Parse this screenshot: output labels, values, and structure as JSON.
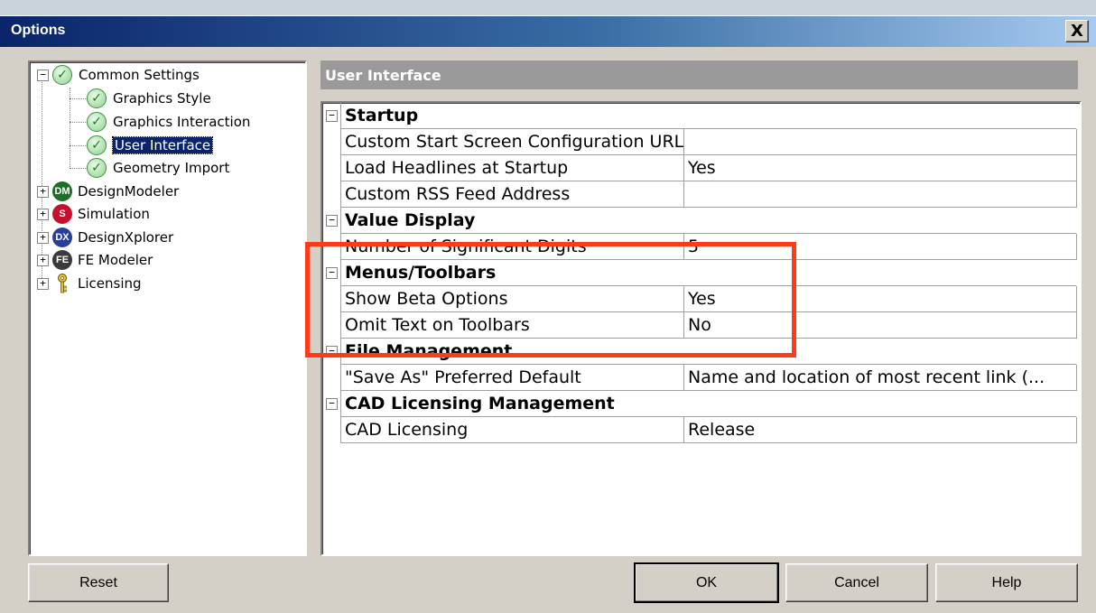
{
  "window": {
    "title": "Options",
    "close_glyph": "X"
  },
  "tree": {
    "items": [
      {
        "label": "Common Settings",
        "icon": "check-icon",
        "expander": "−"
      },
      {
        "label": "Graphics Style",
        "icon": "check-icon"
      },
      {
        "label": "Graphics Interaction",
        "icon": "check-icon"
      },
      {
        "label": "User Interface",
        "icon": "check-icon",
        "selected": true
      },
      {
        "label": "Geometry Import",
        "icon": "check-icon"
      },
      {
        "label": "DesignModeler",
        "icon": "designmodeler-icon",
        "badge": "DM",
        "color": "#1e6e2a",
        "expander": "+"
      },
      {
        "label": "Simulation",
        "icon": "simulation-icon",
        "badge": "S",
        "color": "#c8102e",
        "expander": "+"
      },
      {
        "label": "DesignXplorer",
        "icon": "designxplorer-icon",
        "badge": "DX",
        "color": "#2a3f9a",
        "expander": "+"
      },
      {
        "label": "FE Modeler",
        "icon": "fe-modeler-icon",
        "badge": "FE",
        "color": "#3a3a3a",
        "expander": "+"
      },
      {
        "label": "Licensing",
        "icon": "key-icon",
        "expander": "+"
      }
    ]
  },
  "panel": {
    "title": "User Interface"
  },
  "grid": {
    "collapse_glyph": "−",
    "rows": [
      {
        "type": "category",
        "label": "Startup"
      },
      {
        "type": "prop",
        "name": "Custom Start Screen Configuration URL",
        "value": ""
      },
      {
        "type": "prop",
        "name": "Load Headlines at Startup",
        "value": "Yes"
      },
      {
        "type": "prop",
        "name": "Custom RSS Feed Address",
        "value": ""
      },
      {
        "type": "category",
        "label": "Value Display"
      },
      {
        "type": "prop",
        "name": "Number of Significant Digits",
        "value": "5"
      },
      {
        "type": "category",
        "label": "Menus/Toolbars"
      },
      {
        "type": "prop",
        "name": "Show Beta Options",
        "value": "Yes"
      },
      {
        "type": "prop",
        "name": "Omit Text on Toolbars",
        "value": "No"
      },
      {
        "type": "category",
        "label": "File Management"
      },
      {
        "type": "prop",
        "name": "\"Save As\" Preferred Default",
        "value": "Name and location of most recent link (..."
      },
      {
        "type": "category",
        "label": "CAD Licensing Management"
      },
      {
        "type": "prop",
        "name": "CAD Licensing",
        "value": "Release"
      }
    ]
  },
  "buttons": {
    "reset": "Reset",
    "ok": "OK",
    "cancel": "Cancel",
    "help": "Help"
  },
  "colors": {
    "highlight": "#ff3b1a",
    "title_start": "#0a246a",
    "selection": "#0a246a"
  }
}
